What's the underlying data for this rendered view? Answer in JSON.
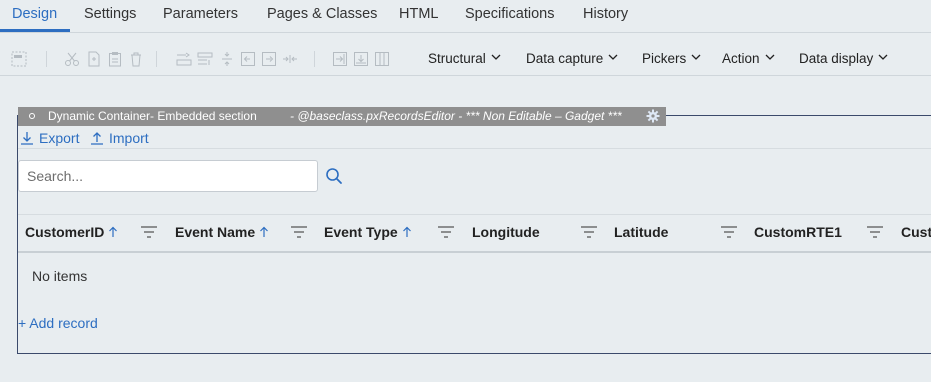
{
  "tabs": [
    {
      "label": "Design",
      "active": true
    },
    {
      "label": "Settings"
    },
    {
      "label": "Parameters"
    },
    {
      "label": "Pages & Classes"
    },
    {
      "label": "HTML"
    },
    {
      "label": "Specifications"
    },
    {
      "label": "History"
    }
  ],
  "toolbar": {
    "icons": [
      "layout-icon",
      "cut-icon",
      "copy-icon",
      "paste-icon",
      "delete-icon",
      "insert-row-icon",
      "merge-icon",
      "split-icon",
      "move-left-icon",
      "move-right-icon",
      "collapse-icon",
      "add-column-icon",
      "add-row-icon",
      "columns-icon"
    ],
    "menus": [
      {
        "label": "Structural"
      },
      {
        "label": "Data capture"
      },
      {
        "label": "Pickers"
      },
      {
        "label": "Action"
      },
      {
        "label": "Data display"
      }
    ]
  },
  "section": {
    "title": "Dynamic Container- Embedded section",
    "subtitle": "- @baseclass.pxRecordsEditor - *** Non Editable – Gadget ***",
    "icon": "gear-icon"
  },
  "links": {
    "export": "Export",
    "import": "Import"
  },
  "search": {
    "placeholder": "Search...",
    "value": ""
  },
  "grid": {
    "columns": [
      {
        "label": "CustomerID",
        "sortable": true
      },
      {
        "label": "Event Name",
        "sortable": true
      },
      {
        "label": "Event Type",
        "sortable": true
      },
      {
        "label": "Longitude",
        "sortable": false
      },
      {
        "label": "Latitude",
        "sortable": false
      },
      {
        "label": "CustomRTE1",
        "sortable": false
      },
      {
        "label": "Cust",
        "sortable": false
      }
    ],
    "empty_text": "No items",
    "add_label": "+ Add record"
  },
  "colors": {
    "accent": "#2d6ec1",
    "background": "#e8edf0",
    "section_header": "#8f8f8f"
  }
}
